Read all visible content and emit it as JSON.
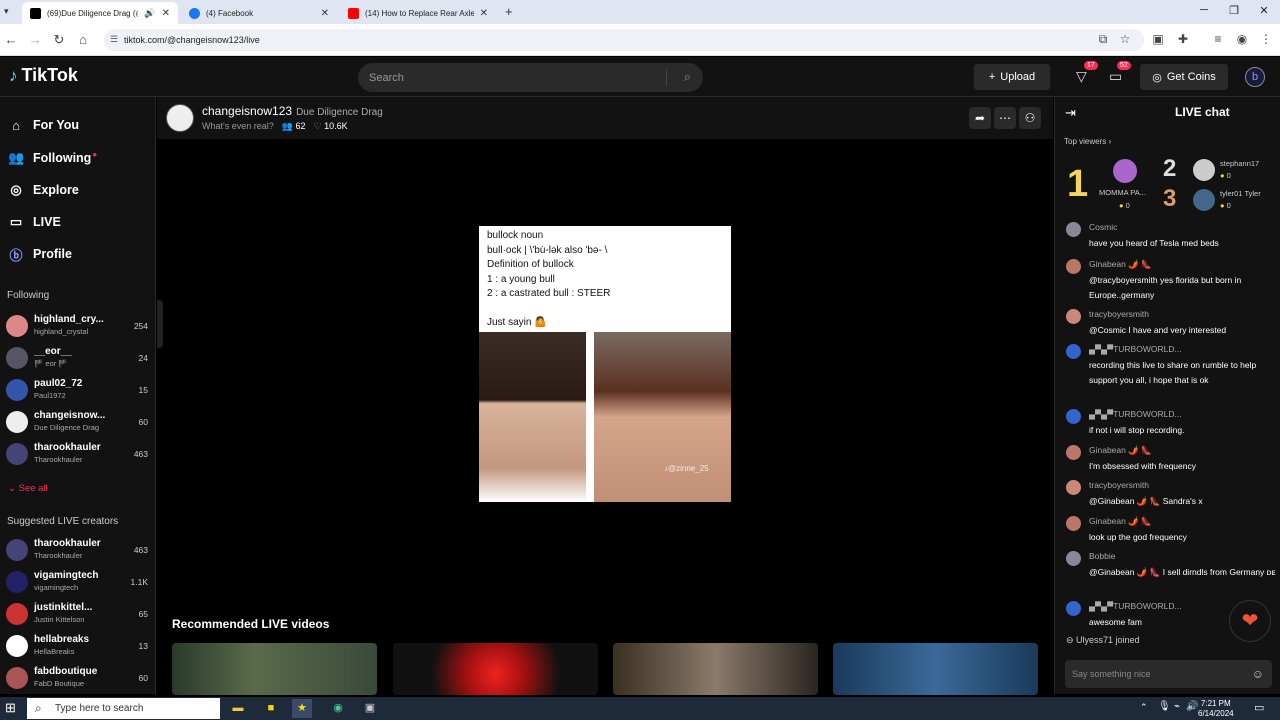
{
  "browser": {
    "tabs": [
      {
        "label": "(69)Due Diligence Drag (@c",
        "active": true
      },
      {
        "label": "(4) Facebook",
        "active": false
      },
      {
        "label": "(14) How to Replace Rear Axle",
        "active": false
      }
    ],
    "new_tab": "+",
    "url": "tiktok.com/@changeisnow123/live"
  },
  "header": {
    "logo": "TikTok",
    "search_placeholder": "Search",
    "upload": "Upload",
    "inbox_badge": "17",
    "messages_badge": "52",
    "get_coins": "Get Coins"
  },
  "sidebar": {
    "nav": [
      {
        "label": "For You",
        "icon": "home-icon"
      },
      {
        "label": "Following",
        "icon": "people-icon"
      },
      {
        "label": "Explore",
        "icon": "compass-icon"
      },
      {
        "label": "LIVE",
        "icon": "live-icon"
      },
      {
        "label": "Profile",
        "icon": "profile-icon"
      }
    ],
    "following_title": "Following",
    "following": [
      {
        "name": "highland_cry...",
        "sub": "highland_crystal",
        "count": "254",
        "color": "#d88"
      },
      {
        "name": "__eor__",
        "sub": "🏴 eor 🏴",
        "count": "24",
        "color": "#556"
      },
      {
        "name": "paul02_72",
        "sub": "Paul1972",
        "count": "15",
        "color": "#35a"
      },
      {
        "name": "changeisnow...",
        "sub": "Due Diligence Drag",
        "count": "60",
        "color": "#eee"
      },
      {
        "name": "tharookhauler",
        "sub": "Tharookhauler",
        "count": "463",
        "color": "#447"
      }
    ],
    "see_all": "See all",
    "suggested_title": "Suggested LIVE creators",
    "suggested": [
      {
        "name": "tharookhauler",
        "sub": "Tharookhauler",
        "count": "463",
        "color": "#447"
      },
      {
        "name": "vigamingtech",
        "sub": "vigamingtech",
        "count": "1.1K",
        "color": "#226"
      },
      {
        "name": "justinkittel...",
        "sub": "Justin Kittelson",
        "count": "65",
        "color": "#c33"
      },
      {
        "name": "hellabreaks",
        "sub": "HellaBreaks",
        "count": "13",
        "color": "#fff"
      },
      {
        "name": "fabdboutique",
        "sub": "FabD Boutique",
        "count": "60",
        "color": "#a55"
      }
    ]
  },
  "stream": {
    "username": "changeisnow123",
    "title": "Due Diligence Drag",
    "subtitle": "What's even real?",
    "viewers": "62",
    "likes": "10.6K",
    "card": {
      "lines": [
        "bullock noun",
        "bull·ock | \\'bu̇-lək also 'bə- \\",
        "Definition of bullock",
        "1 : a young bull",
        "2 : a castrated bull : STEER",
        "",
        "Just sayin 🤷"
      ],
      "watermark": "@zinne_25"
    },
    "recommended_title": "Recommended LIVE videos"
  },
  "chat": {
    "title": "LIVE chat",
    "top_viewers_label": "Top viewers",
    "top": [
      {
        "rank": "1",
        "name": "MOMMA PA...",
        "coins": "0"
      },
      {
        "rank": "2",
        "name": "stephann17",
        "coins": "0"
      },
      {
        "rank": "3",
        "name": "tyler01 Tyler",
        "coins": "0"
      }
    ],
    "messages": [
      {
        "user": "Cosmic",
        "text": "have you heard of Tesla med beds",
        "color": "#889"
      },
      {
        "user": "Ginabean 🌶️ 👠",
        "text": "@tracyboyersmith yes florida but born in Europe..germany",
        "color": "#b76"
      },
      {
        "user": "tracyboyersmith",
        "text": "@Cosmic I have and very interested",
        "color": "#c87"
      },
      {
        "user": "▄▀▄▀TURBOWORLD...",
        "text": "recording this live to share on rumble to help support you all, i hope that is ok",
        "color": "#36c"
      },
      {
        "user": "▄▀▄▀TURBOWORLD...",
        "text": "if not i will stop recording.",
        "color": "#36c"
      },
      {
        "user": "Ginabean 🌶️ 👠",
        "text": "I'm obsessed with frequency",
        "color": "#b76"
      },
      {
        "user": "tracyboyersmith",
        "text": "@Ginabean 🌶️ 👠 Sandra's x",
        "color": "#c87"
      },
      {
        "user": "Ginabean 🌶️ 👠",
        "text": "look up the god frequency",
        "color": "#b76"
      },
      {
        "user": "Bobbie",
        "text": "@Ginabean 🌶️ 👠 I sell dirndls from Germany ᴅᴇ",
        "color": "#889"
      },
      {
        "user": "▄▀▄▀TURBOWORLD...",
        "text": "awesome fam",
        "color": "#36c"
      }
    ],
    "joined": "Ulyess71 joined",
    "input_placeholder": "Say something nice"
  },
  "taskbar": {
    "search": "Type here to search",
    "time": "7:21 PM",
    "date": "6/14/2024"
  }
}
